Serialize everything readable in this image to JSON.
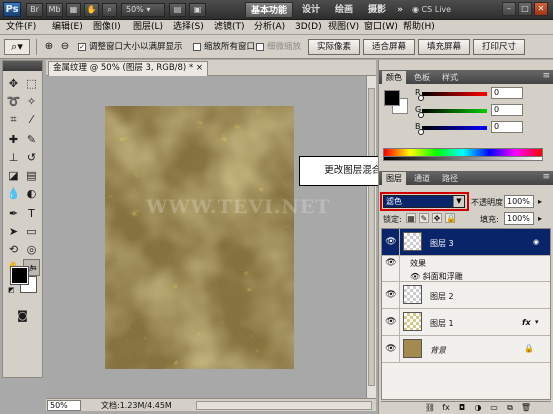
{
  "app": {
    "logo": "Ps",
    "bridge_icon": "Br",
    "mini_bridge_icon": "Mb",
    "zoom_level": "50%",
    "workspaces": [
      "基本功能",
      "设计",
      "绘画",
      "摄影"
    ],
    "more_workspaces": "»",
    "cs_live": "CS Live",
    "window_controls": [
      "–",
      "□",
      "✕"
    ]
  },
  "menu": [
    "文件(F)",
    "编辑(E)",
    "图像(I)",
    "图层(L)",
    "选择(S)",
    "滤镜(T)",
    "分析(A)",
    "3D(D)",
    "视图(V)",
    "窗口(W)",
    "帮助(H)"
  ],
  "options": {
    "resize_windows_label": "调整窗口大小以满屏显示",
    "zoom_all_label": "缩放所有窗口",
    "scrubby_zoom_label": "细微缩放",
    "actual_pixels": "实际像素",
    "fit_screen": "适合屏幕",
    "fill_screen": "填充屏幕",
    "print_size": "打印尺寸"
  },
  "document": {
    "tab_title": "金属纹理 @ 50% (图层 3, RGB/8) *",
    "close": "×",
    "zoom": "50%",
    "doc_info": "文档:1.23M/4.45M",
    "watermark": "WWW.TEVI.NET"
  },
  "callout": "更改图层混合模式为 “滤色” 模式",
  "color_panel": {
    "tabs": [
      "颜色",
      "色板",
      "样式"
    ],
    "channels": [
      {
        "label": "R",
        "value": "0"
      },
      {
        "label": "G",
        "value": "0"
      },
      {
        "label": "B",
        "value": "0"
      }
    ]
  },
  "layers_panel": {
    "tabs": [
      "图层",
      "通道",
      "路径"
    ],
    "blend_mode": "滤色",
    "opacity_label": "不透明度:",
    "opacity_value": "100%",
    "lock_label": "锁定:",
    "fill_label": "填充:",
    "fill_value": "100%",
    "layers": [
      {
        "name": "图层 3",
        "selected": true
      },
      {
        "name": "效果",
        "effect_header": true
      },
      {
        "name": "斜面和浮雕",
        "effect": true
      },
      {
        "name": "图层 2"
      },
      {
        "name": "图层 1",
        "fx": "fx"
      },
      {
        "name": "背景",
        "locked": true
      }
    ]
  },
  "colors": {
    "accent_selection": "#0a246a",
    "callout_border": "#d20000",
    "appbar": "#3b3b3b",
    "chrome": "#d4d0c8"
  }
}
